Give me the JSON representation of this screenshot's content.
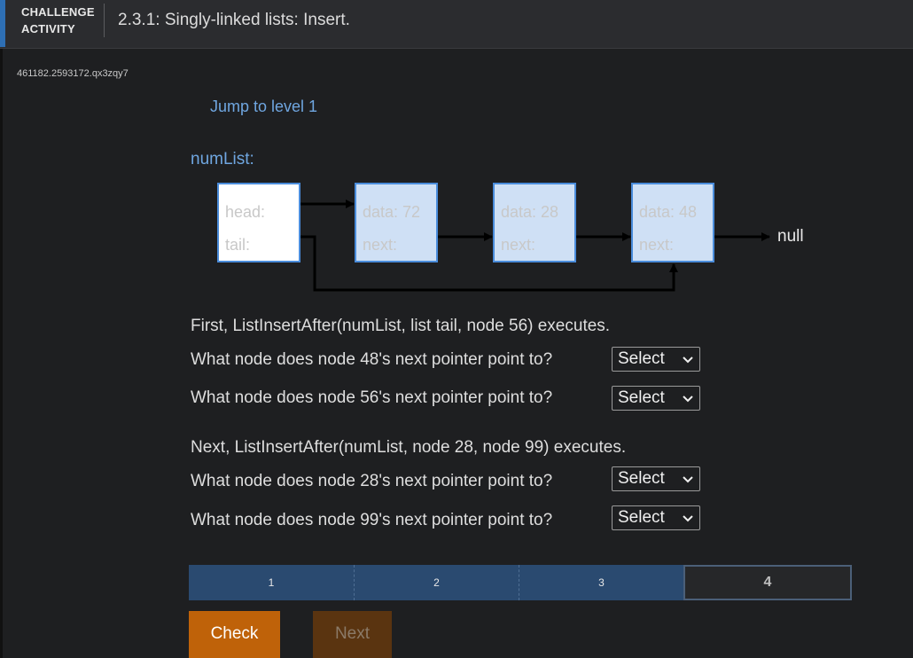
{
  "header": {
    "kind_line1": "CHALLENGE",
    "kind_line2": "ACTIVITY",
    "title": "2.3.1: Singly-linked lists: Insert."
  },
  "activity_id": "461182.2593172.qx3zqy7",
  "jump_label": "Jump to level 1",
  "diagram": {
    "list_name": "numList:",
    "list_node": {
      "head_label": "head:",
      "tail_label": "tail:"
    },
    "nodes": [
      {
        "data_label": "data: 72",
        "next_label": "next:"
      },
      {
        "data_label": "data: 28",
        "next_label": "next:"
      },
      {
        "data_label": "data: 48",
        "next_label": "next:"
      }
    ],
    "null_label": "null"
  },
  "step1": {
    "intro": "First, ListInsertAfter(numList, list tail, node 56) executes.",
    "questions": [
      {
        "text": "What node does node 48's next pointer point to?",
        "select_value": "Select"
      },
      {
        "text": "What node does node 56's next pointer point to?",
        "select_value": "Select"
      }
    ]
  },
  "step2": {
    "intro": "Next, ListInsertAfter(numList, node 28, node 99) executes.",
    "questions": [
      {
        "text": "What node does node 28's next pointer point to?",
        "select_value": "Select"
      },
      {
        "text": "What node does node 99's next pointer point to?",
        "select_value": "Select"
      }
    ]
  },
  "levels": [
    "1",
    "2",
    "3",
    "4"
  ],
  "current_level": "4",
  "buttons": {
    "check": "Check",
    "next": "Next"
  },
  "colors": {
    "accent": "#2e6fb4",
    "link": "#6fa6e0",
    "node_fill": "#cfe0f5",
    "node_border": "#4a8cdb",
    "check_button": "#bf6209",
    "next_button_disabled": "#5a3410",
    "progress_done": "#2a4a70"
  },
  "icons": {
    "select_arrow": "chevron-down-icon"
  }
}
